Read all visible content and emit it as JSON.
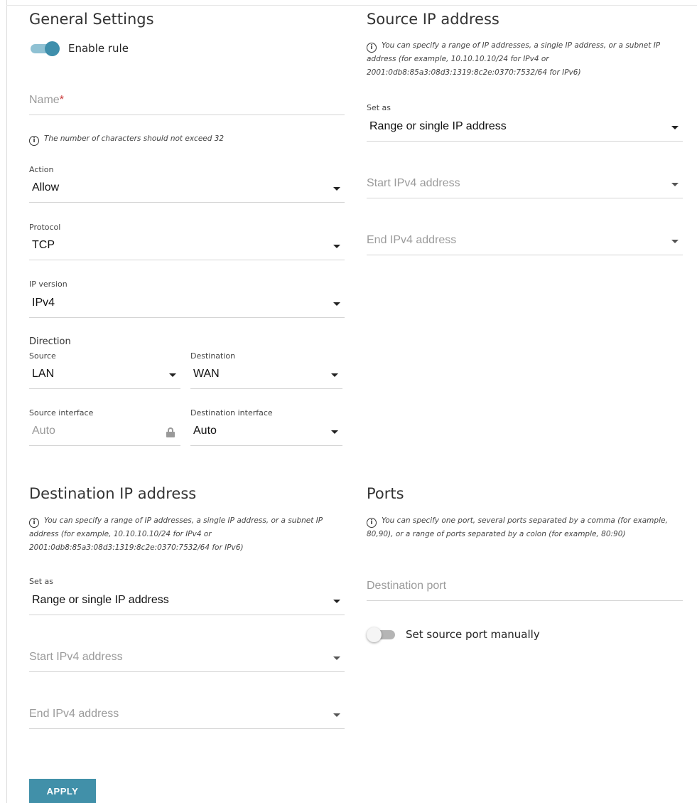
{
  "general": {
    "title": "General Settings",
    "enable_rule": {
      "label": "Enable rule",
      "on": true
    },
    "name": {
      "placeholder": "Name",
      "required_mark": "*"
    },
    "name_hint": "The number of characters should not exceed 32",
    "action": {
      "label": "Action",
      "value": "Allow"
    },
    "protocol": {
      "label": "Protocol",
      "value": "TCP"
    },
    "ip_version": {
      "label": "IP version",
      "value": "IPv4"
    },
    "direction": {
      "label": "Direction",
      "source_label": "Source",
      "source_value": "LAN",
      "destination_label": "Destination",
      "destination_value": "WAN"
    },
    "source_interface": {
      "label": "Source interface",
      "value": "Auto"
    },
    "destination_interface": {
      "label": "Destination interface",
      "value": "Auto"
    }
  },
  "source_ip": {
    "title": "Source IP address",
    "hint": "You can specify a range of IP addresses, a single IP address, or a subnet IP address (for example, 10.10.10.10/24 for IPv4 or 2001:0db8:85a3:08d3:1319:8c2e:0370:7532/64 for IPv6)",
    "set_as_label": "Set as",
    "set_as_value": "Range or single IP address",
    "start_placeholder": "Start IPv4 address",
    "end_placeholder": "End IPv4 address"
  },
  "destination_ip": {
    "title": "Destination IP address",
    "hint": "You can specify a range of IP addresses, a single IP address, or a subnet IP address (for example, 10.10.10.10/24 for IPv4 or 2001:0db8:85a3:08d3:1319:8c2e:0370:7532/64 for IPv6)",
    "set_as_label": "Set as",
    "set_as_value": "Range or single IP address",
    "start_placeholder": "Start IPv4 address",
    "end_placeholder": "End IPv4 address"
  },
  "ports": {
    "title": "Ports",
    "hint": "You can specify one port, several ports separated by a comma (for example, 80,90), or a range of ports separated by a colon (for example, 80:90)",
    "destination_port_placeholder": "Destination port",
    "source_port_manual": {
      "label": "Set source port manually",
      "on": false
    }
  },
  "apply_label": "APPLY",
  "info_icon_glyph": "i",
  "colors": {
    "accent": "#4190a9",
    "toggle_on_track": "#8fc1d3",
    "toggle_on_knob": "#3f8fac",
    "required": "#c83232"
  }
}
